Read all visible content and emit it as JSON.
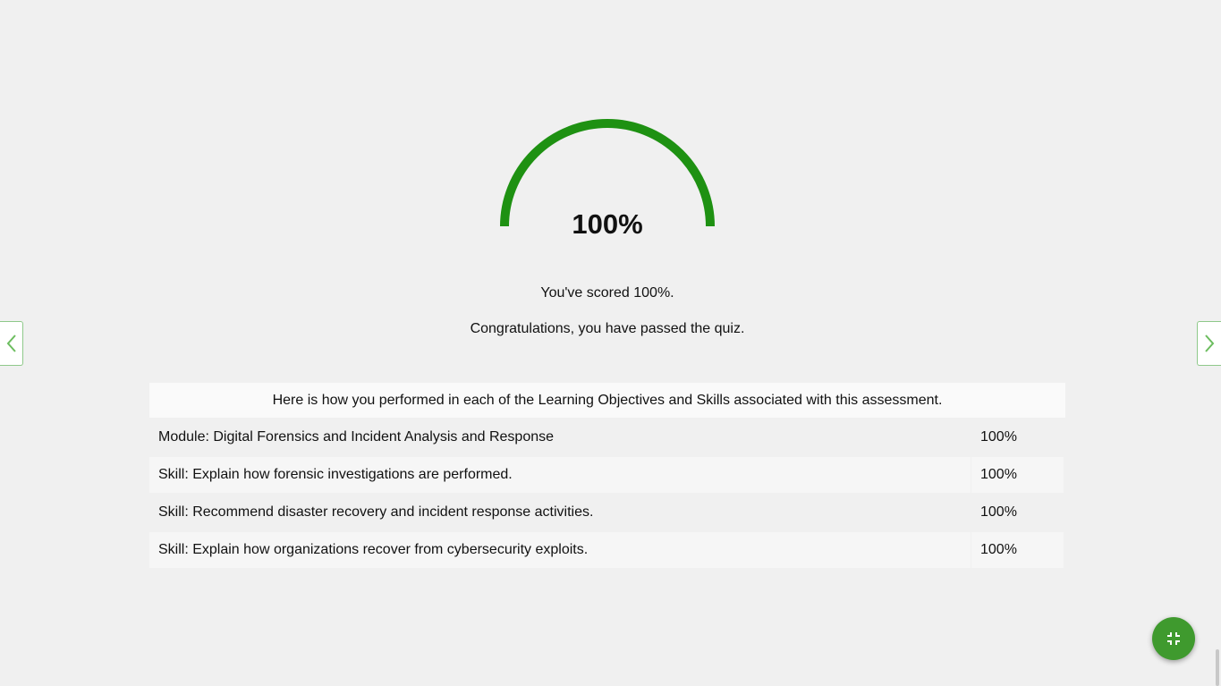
{
  "score": {
    "value": "100%",
    "fraction": 1.0,
    "color": "#1e9112",
    "scored_message": "You've scored 100%.",
    "result_message": "Congratulations, you have passed the quiz."
  },
  "results": {
    "header": "Here is how you performed in each of the Learning Objectives and Skills associated with this assessment.",
    "rows": [
      {
        "label": "Module: Digital Forensics and Incident Analysis and Response",
        "percent": "100%"
      },
      {
        "label": "Skill: Explain how forensic investigations are performed.",
        "percent": "100%"
      },
      {
        "label": "Skill: Recommend disaster recovery and incident response activities.",
        "percent": "100%"
      },
      {
        "label": "Skill: Explain how organizations recover from cybersecurity exploits.",
        "percent": "100%"
      }
    ]
  },
  "navigation": {
    "prev_icon": "chevron-left-icon",
    "next_icon": "chevron-right-icon",
    "accent": "#6cbd5f"
  },
  "fab": {
    "icon": "collapse-icon",
    "color": "#3f9a2e"
  }
}
